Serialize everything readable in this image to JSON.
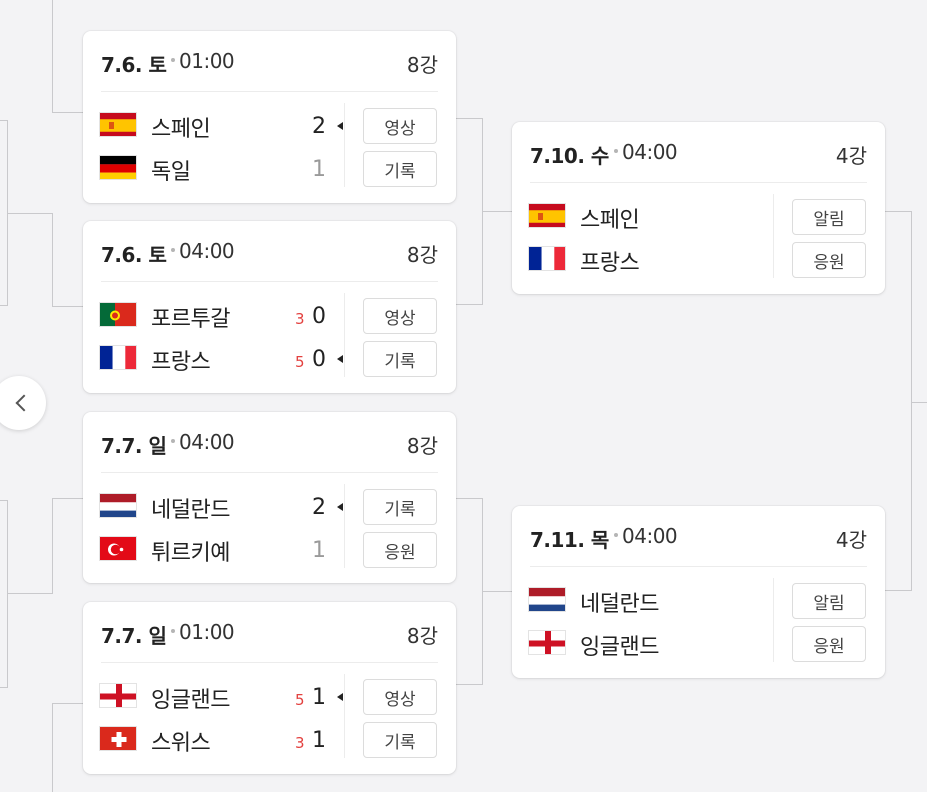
{
  "bracket": {
    "quarterfinals": [
      {
        "date": "7.6. 토",
        "time": "01:00",
        "round": "8강",
        "teams": [
          {
            "name": "스페인",
            "flag": "spain-flag-icon",
            "score": "2",
            "pk": "",
            "winner": true,
            "button": "영상"
          },
          {
            "name": "독일",
            "flag": "germany-flag-icon",
            "score": "1",
            "pk": "",
            "winner": false,
            "button": "기록"
          }
        ]
      },
      {
        "date": "7.6. 토",
        "time": "04:00",
        "round": "8강",
        "teams": [
          {
            "name": "포르투갈",
            "flag": "portugal-flag-icon",
            "score": "0",
            "pk": "3",
            "winner": false,
            "button": "영상"
          },
          {
            "name": "프랑스",
            "flag": "france-flag-icon",
            "score": "0",
            "pk": "5",
            "winner": true,
            "button": "기록"
          }
        ]
      },
      {
        "date": "7.7. 일",
        "time": "04:00",
        "round": "8강",
        "teams": [
          {
            "name": "네덜란드",
            "flag": "netherlands-flag-icon",
            "score": "2",
            "pk": "",
            "winner": true,
            "button": "기록"
          },
          {
            "name": "튀르키예",
            "flag": "turkey-flag-icon",
            "score": "1",
            "pk": "",
            "winner": false,
            "button": "응원"
          }
        ]
      },
      {
        "date": "7.7. 일",
        "time": "01:00",
        "round": "8강",
        "teams": [
          {
            "name": "잉글랜드",
            "flag": "england-flag-icon",
            "score": "1",
            "pk": "5",
            "winner": true,
            "button": "영상"
          },
          {
            "name": "스위스",
            "flag": "switzerland-flag-icon",
            "score": "1",
            "pk": "3",
            "winner": false,
            "button": "기록"
          }
        ]
      }
    ],
    "semifinals": [
      {
        "date": "7.10. 수",
        "time": "04:00",
        "round": "4강",
        "teams": [
          {
            "name": "스페인",
            "flag": "spain-flag-icon",
            "button": "알림"
          },
          {
            "name": "프랑스",
            "flag": "france-flag-icon",
            "button": "응원"
          }
        ]
      },
      {
        "date": "7.11. 목",
        "time": "04:00",
        "round": "4강",
        "teams": [
          {
            "name": "네덜란드",
            "flag": "netherlands-flag-icon",
            "button": "알림"
          },
          {
            "name": "잉글랜드",
            "flag": "england-flag-icon",
            "button": "응원"
          }
        ]
      }
    ],
    "nav": {
      "prev_icon": "chevron-left-icon"
    }
  }
}
